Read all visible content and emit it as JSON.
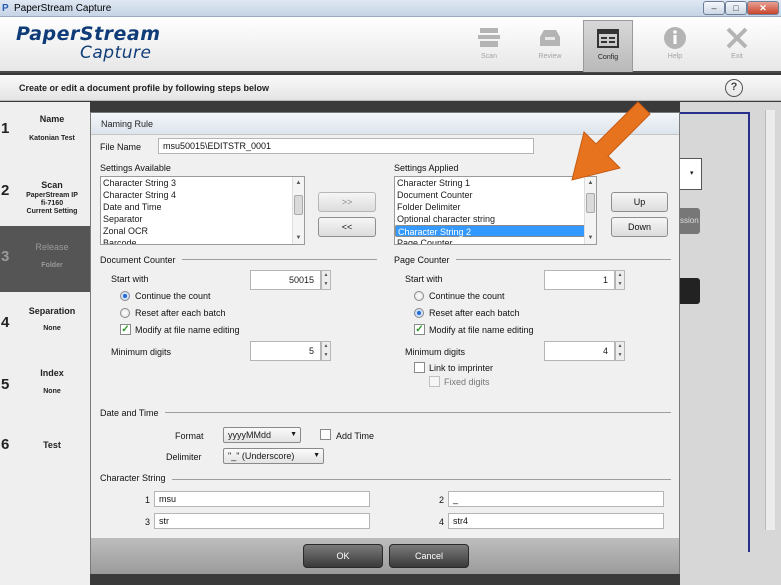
{
  "window": {
    "title": "PaperStream Capture",
    "icon": "P",
    "min": "–",
    "max": "□",
    "close": "✕"
  },
  "header": {
    "logo_line1": "PaperStream",
    "logo_line2": "Capture",
    "toolbar": [
      {
        "label": "Scan",
        "icon": "scanner-icon"
      },
      {
        "label": "Review",
        "icon": "tray-icon"
      },
      {
        "label": "Config",
        "icon": "config-window-icon",
        "active": true
      },
      {
        "label": "Help",
        "icon": "info-icon"
      },
      {
        "label": "Exit",
        "icon": "close-x-icon"
      }
    ]
  },
  "stepbar": {
    "text": "Create or edit a document profile by following steps below",
    "help": "?"
  },
  "steps": [
    {
      "num": "1",
      "name": "Name",
      "sub": "Katonian Test"
    },
    {
      "num": "2",
      "name": "Scan",
      "sub1": "PaperStream IP",
      "sub2": "fi-7160",
      "sub3": "Current Setting"
    },
    {
      "num": "3",
      "name": "Release",
      "sub": "Folder",
      "active": true
    },
    {
      "num": "4",
      "name": "Separation",
      "sub": "None"
    },
    {
      "num": "5",
      "name": "Index",
      "sub": "None"
    },
    {
      "num": "6",
      "name": "Test",
      "sub": ""
    }
  ],
  "background_fragments": {
    "ession": "ssion"
  },
  "dialog": {
    "title": "Naming Rule",
    "file_name_label": "File Name",
    "file_name_value": "msu50015\\EDITSTR_0001",
    "settings_available_label": "Settings Available",
    "settings_available": [
      "Character String 3",
      "Character String 4",
      "Date and Time",
      "Separator",
      "Zonal OCR",
      "Barcode"
    ],
    "settings_applied_label": "Settings Applied",
    "settings_applied": [
      "Character String 1",
      "Document Counter",
      "Folder Delimiter",
      "Optional character string",
      "Character String 2",
      "Page Counter"
    ],
    "settings_applied_selected_index": 4,
    "add_button": ">>",
    "remove_button": "<<",
    "up_button": "Up",
    "down_button": "Down",
    "doc_counter": {
      "title": "Document Counter",
      "start_with_label": "Start with",
      "start_with_value": "50015",
      "continue_label": "Continue the count",
      "reset_label": "Reset after each batch",
      "modify_label": "Modify at file name editing",
      "min_digits_label": "Minimum digits",
      "min_digits_value": "5"
    },
    "page_counter": {
      "title": "Page Counter",
      "start_with_label": "Start with",
      "start_with_value": "1",
      "continue_label": "Continue the count",
      "reset_label": "Reset after each batch",
      "modify_label": "Modify at file name editing",
      "min_digits_label": "Minimum digits",
      "min_digits_value": "4",
      "link_label": "Link to imprinter",
      "fixed_label": "Fixed digits"
    },
    "date_time": {
      "title": "Date and Time",
      "format_label": "Format",
      "format_value": "yyyyMMdd",
      "add_time_label": "Add Time",
      "delimiter_label": "Delimiter",
      "delimiter_value": "\"_\" (Underscore)"
    },
    "char_string": {
      "title": "Character String",
      "items": [
        {
          "num": "1",
          "value": "msu"
        },
        {
          "num": "2",
          "value": "_"
        },
        {
          "num": "3",
          "value": "str"
        },
        {
          "num": "4",
          "value": "str4"
        }
      ]
    },
    "ok_button": "OK",
    "cancel_button": "Cancel"
  },
  "colors": {
    "accent_arrow": "#e8731f",
    "brand": "#0f3c78",
    "selection": "#3399ff"
  }
}
